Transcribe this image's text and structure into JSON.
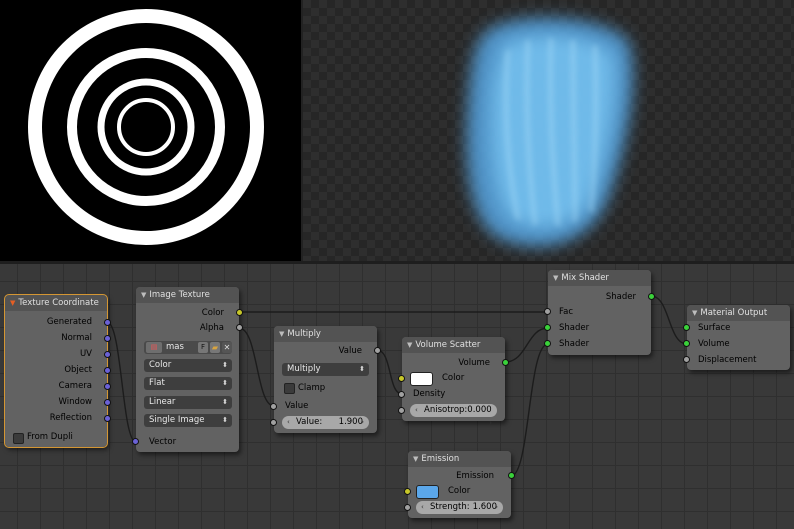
{
  "colors": {
    "emission_swatch": "#5ba7ea",
    "scatter_swatch": "#ffffff",
    "wire": "#1c1c1c",
    "active_outline": "#d49633"
  },
  "nodes": {
    "texture_coordinate": {
      "title": "Texture Coordinate",
      "outputs": [
        "Generated",
        "Normal",
        "UV",
        "Object",
        "Camera",
        "Window",
        "Reflection"
      ],
      "from_dupli": "From Dupli"
    },
    "image_texture": {
      "title": "Image Texture",
      "outputs": [
        "Color",
        "Alpha"
      ],
      "image_name": "mas",
      "fake_user": "F",
      "color_space": "Color",
      "projection": "Flat",
      "interpolation": "Linear",
      "source": "Single Image",
      "input_vector": "Vector"
    },
    "multiply": {
      "title": "Multiply",
      "output": "Value",
      "operation": "Multiply",
      "clamp": "Clamp",
      "input_value": "Value",
      "value_label": "Value:",
      "value": "1.900"
    },
    "volume_scatter": {
      "title": "Volume Scatter",
      "output": "Volume",
      "input_color": "Color",
      "input_density": "Density",
      "anisotropy_label": "Anisotrop:",
      "anisotropy": "0.000"
    },
    "mix_shader": {
      "title": "Mix Shader",
      "output": "Shader",
      "inputs": [
        "Fac",
        "Shader",
        "Shader"
      ]
    },
    "material_output": {
      "title": "Material Output",
      "inputs": [
        "Surface",
        "Volume",
        "Displacement"
      ]
    },
    "emission": {
      "title": "Emission",
      "output": "Emission",
      "input_color": "Color",
      "strength_label": "Strength:",
      "strength": "1.600"
    }
  }
}
